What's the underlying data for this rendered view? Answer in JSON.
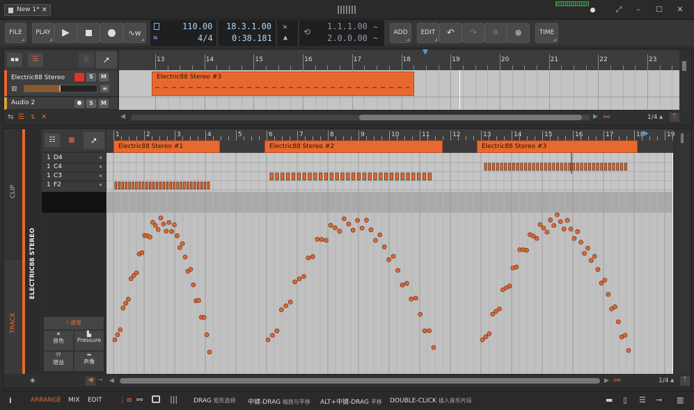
{
  "window": {
    "tab_title": "New 1*",
    "close": "✕"
  },
  "toolbar": {
    "file": "FILE",
    "play": "PLAY",
    "add": "ADD",
    "edit": "EDIT",
    "time": "TIME"
  },
  "transport": {
    "tempo": "110.00",
    "signature": "4/4",
    "position_bars": "18.3.1.00",
    "position_time": "0:38.181",
    "loop_start": "1.1.1.00",
    "loop_length": "2.0.0.00"
  },
  "arranger": {
    "ruler": [
      "13",
      "14",
      "15",
      "16",
      "17",
      "18",
      "19",
      "20",
      "21",
      "22",
      "23"
    ],
    "tracks": [
      {
        "name": "Electric88 Stereo",
        "s": "S",
        "m": "M"
      },
      {
        "name": "Audio 2",
        "s": "S",
        "m": "M"
      }
    ],
    "clip": "Electric88 Stereo #3",
    "grid": "1/4"
  },
  "editor": {
    "ruler": [
      "1",
      "2",
      "3",
      "4",
      "5",
      "6",
      "7",
      "8",
      "9",
      "10",
      "11",
      "12",
      "13",
      "14",
      "15",
      "16",
      "17",
      "18",
      "19"
    ],
    "clips": [
      "Electric88 Stereo #1",
      "Electric88 Stereo #2",
      "Electric88 Stereo #3"
    ],
    "keys": [
      {
        "n": "1",
        "k": "D4"
      },
      {
        "n": "1",
        "k": "C4"
      },
      {
        "n": "1",
        "k": "C3"
      },
      {
        "n": "1",
        "k": "F2"
      }
    ],
    "track_label": "ELECTRIC88 STEREO",
    "side_clip": "CLIP",
    "side_track": "TRACK",
    "expr": {
      "velocity": "速度",
      "timbre": "音色",
      "pressure": "Pressure",
      "gain": "增益",
      "pan": "声像"
    },
    "grid": "1/4"
  },
  "status": {
    "arrange": "ARRANGE",
    "mix": "MIX",
    "edit": "EDIT",
    "hints": [
      {
        "k": "DRAG",
        "v": "矩形选择"
      },
      {
        "k": "中键-DRAG",
        "v": "缩放与平移"
      },
      {
        "k": "ALT+中键-DRAG",
        "v": "平移"
      },
      {
        "k": "DOUBLE-CLICK",
        "v": "插入音乐片段"
      }
    ]
  },
  "colors": {
    "accent": "#e8692f",
    "lcd": "#a6d6ff",
    "grid": "#c2c2c2",
    "record": "#e53030"
  }
}
